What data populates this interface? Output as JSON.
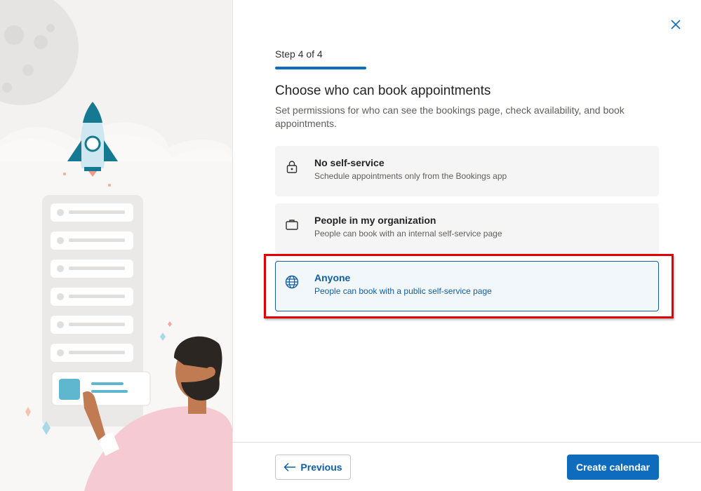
{
  "wizard": {
    "step_label": "Step 4 of 4",
    "title": "Choose who can book appointments",
    "subtitle": "Set permissions for who can see the bookings page, check availability, and book appointments."
  },
  "options": [
    {
      "title": "No self-service",
      "description": "Schedule appointments only from the Bookings app",
      "icon": "lock-icon"
    },
    {
      "title": "People in my organization",
      "description": "People can book with an internal self-service page",
      "icon": "briefcase-icon"
    },
    {
      "title": "Anyone",
      "description": "People can book with a public self-service page",
      "icon": "globe-icon",
      "selected": true
    }
  ],
  "footer": {
    "previous_label": "Previous",
    "create_label": "Create calendar"
  },
  "colors": {
    "accent": "#0f6cbd",
    "selected_bg": "#f2f7fc",
    "highlight": "#e00000"
  }
}
